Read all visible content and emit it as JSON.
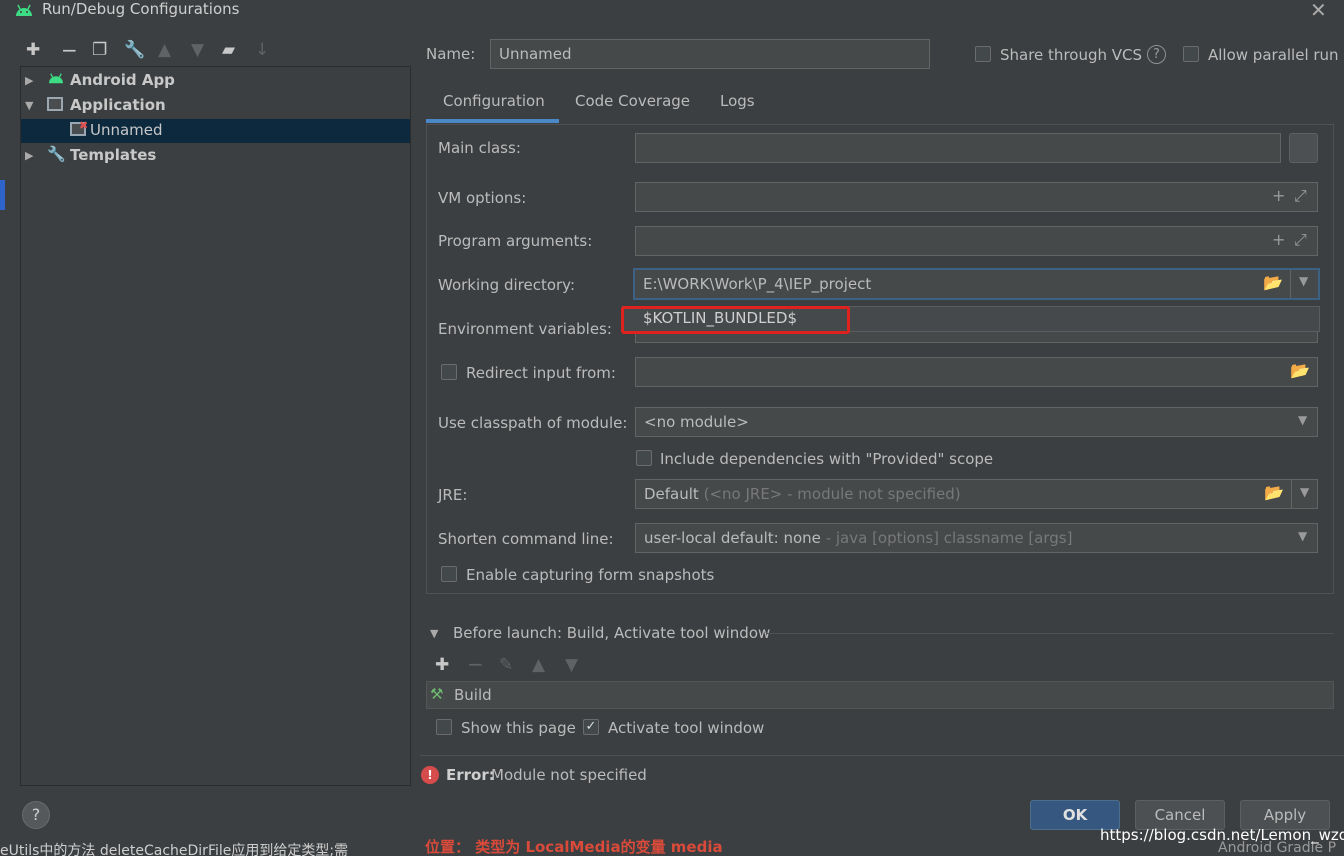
{
  "window": {
    "title": "Run/Debug Configurations"
  },
  "colors": {
    "accent": "#365880",
    "selection": "#0d293e",
    "error": "#e0221f",
    "android": "#3ddc84"
  },
  "toolbar": {
    "icons": [
      "add-icon",
      "remove-icon",
      "copy-icon",
      "wrench-icon",
      "move-up-icon",
      "move-down-icon",
      "folder-icon",
      "sort-icon"
    ]
  },
  "tree": {
    "items": [
      {
        "label": "Android App"
      },
      {
        "label": "Application"
      },
      {
        "label": "Unnamed"
      },
      {
        "label": "Templates"
      }
    ]
  },
  "form": {
    "name_label": "Name:",
    "name_value": "Unnamed",
    "share_vcs": "Share through VCS",
    "allow_parallel": "Allow parallel run",
    "tabs": [
      "Configuration",
      "Code Coverage",
      "Logs"
    ],
    "main_class_label": "Main class:",
    "main_class_value": "",
    "browse": "...",
    "vm_options_label": "VM options:",
    "program_args_label": "Program arguments:",
    "working_dir_label": "Working directory:",
    "working_dir_value": "E:\\WORK\\Work\\P_4\\IEP_project",
    "env_vars_label": "Environment variables:",
    "dropdown_suggestion": "$KOTLIN_BUNDLED$",
    "redirect_label": "Redirect input from:",
    "classpath_label": "Use classpath of module:",
    "classpath_value": "<no module>",
    "include_deps": "Include dependencies with \"Provided\" scope",
    "jre_label": "JRE:",
    "jre_value": "Default",
    "jre_hint": "(<no JRE> - module not specified)",
    "shorten_label": "Shorten command line:",
    "shorten_value": "user-local default: none",
    "shorten_hint": " - java [options] classname [args]",
    "snapshots": "Enable capturing form snapshots"
  },
  "before_launch": {
    "title": "Before launch: Build, Activate tool window",
    "build": "Build",
    "show_page": "Show this page",
    "activate_tool": "Activate tool window"
  },
  "error": {
    "label": "Error:",
    "message": "Module not specified"
  },
  "buttons": {
    "help": "?",
    "ok": "OK",
    "cancel": "Cancel",
    "apply": "Apply"
  },
  "background": {
    "bottom_left": "eUtils中的方法 deleteCacheDirFile应用到给定类型;需",
    "bottom_mid": "位置： 类型为 LocalMedia的变量 media",
    "bottom_right": "Android Gradle P",
    "watermark": "https://blog.csdn.net/Lemon_wzq"
  }
}
